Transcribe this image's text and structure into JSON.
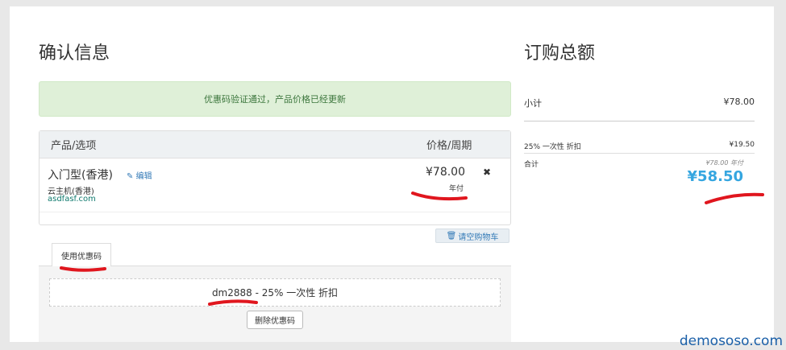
{
  "checkout": {
    "title": "确认信息",
    "alert": "优惠码验证通过，产品价格已经更新",
    "table_headers": {
      "product": "产品/选项",
      "price": "价格/周期"
    },
    "item": {
      "name": "入门型(香港)",
      "edit_label": "编辑",
      "group": "云主机(香港)",
      "domain": "asdfasf.com",
      "price": "¥78.00",
      "cycle": "年付"
    },
    "empty_cart_label": "请空购物车",
    "promo": {
      "tab_label": "使用优惠码",
      "applied_text": "dm2888 - 25% 一次性 折扣",
      "remove_label": "删除优惠码"
    }
  },
  "summary": {
    "title": "订购总额",
    "subtotal_label": "小计",
    "subtotal_value": "¥78.00",
    "discount_label": "25% 一次性 折扣",
    "discount_value": "¥19.50",
    "total_label": "合计",
    "original_price": "¥78.00 年付",
    "total_value": "¥58.50"
  },
  "brand": "demososo.com",
  "colors": {
    "accent_blue": "#35a6e0",
    "annotation_red": "#e0161e",
    "alert_bg": "#dff0d8"
  }
}
